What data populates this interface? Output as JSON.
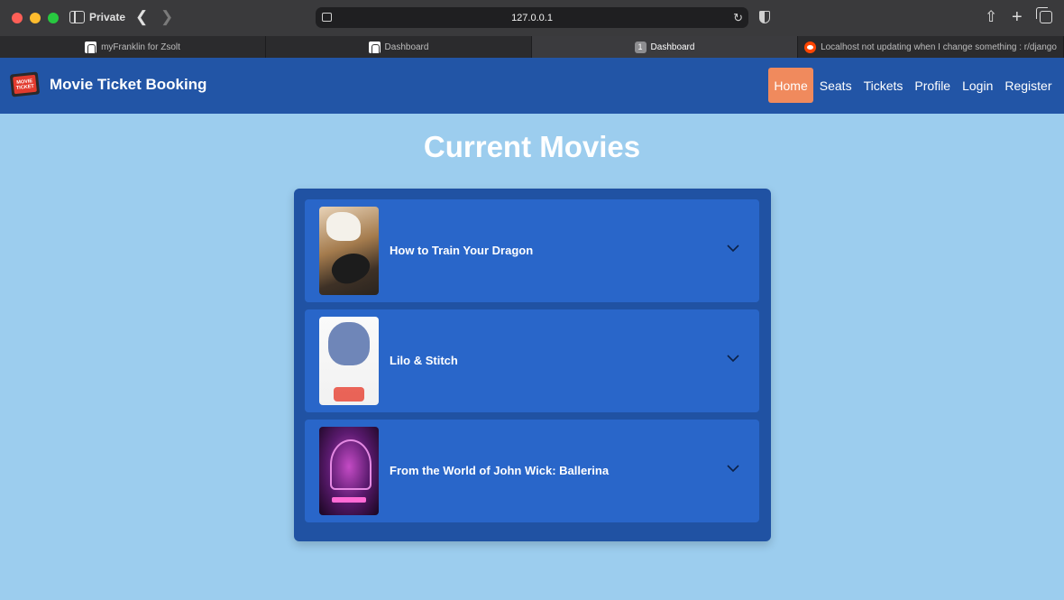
{
  "browser": {
    "private_label": "Private",
    "url": "127.0.0.1",
    "tabs": [
      {
        "label": "myFranklin for Zsolt",
        "active": false,
        "icon": "franklin-icon"
      },
      {
        "label": "Dashboard",
        "active": false,
        "icon": "franklin-icon"
      },
      {
        "label": "Dashboard",
        "active": true,
        "icon": "tab-number-badge",
        "badge": "1"
      },
      {
        "label": "Localhost not updating when I change something : r/django",
        "active": false,
        "icon": "reddit-icon"
      }
    ]
  },
  "navbar": {
    "brand_logo_text": "MOVIE TICKET",
    "brand_title": "Movie Ticket Booking",
    "links": [
      {
        "label": "Home",
        "active": true
      },
      {
        "label": "Seats",
        "active": false
      },
      {
        "label": "Tickets",
        "active": false
      },
      {
        "label": "Profile",
        "active": false
      },
      {
        "label": "Login",
        "active": false
      },
      {
        "label": "Register",
        "active": false
      }
    ]
  },
  "main": {
    "title": "Current Movies",
    "movies": [
      {
        "title": "How to Train Your Dragon",
        "poster": "dragon-poster"
      },
      {
        "title": "Lilo & Stitch",
        "poster": "stitch-poster"
      },
      {
        "title": "From the World of John Wick: Ballerina",
        "poster": "ballerina-poster"
      }
    ]
  },
  "colors": {
    "navbar_bg": "#2255a6",
    "page_bg": "#9ccdee",
    "panel_bg": "#2052a3",
    "card_bg": "#2966c9",
    "active_link_bg": "#f08a5d"
  }
}
